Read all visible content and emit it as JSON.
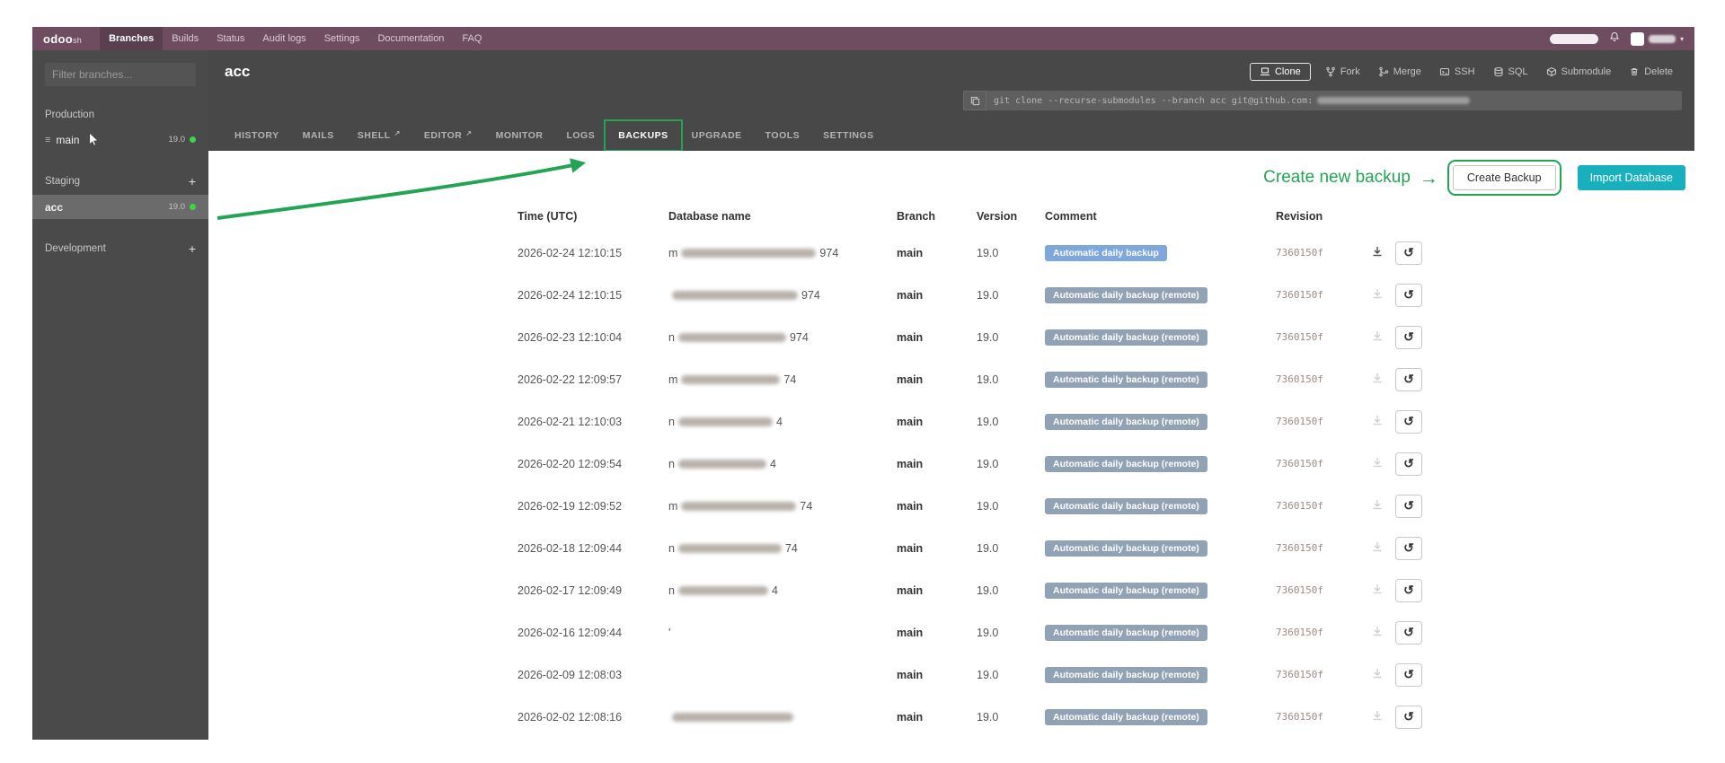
{
  "navbar": {
    "brand": "odoo",
    "brand_suffix": "sh",
    "items": [
      "Branches",
      "Builds",
      "Status",
      "Audit logs",
      "Settings",
      "Documentation",
      "FAQ"
    ],
    "active_item": "Branches"
  },
  "sidebar": {
    "filter_placeholder": "Filter branches...",
    "sections": [
      {
        "label": "Production",
        "can_add": false,
        "branches": [
          {
            "name": "main",
            "version": "19.0",
            "selected": false,
            "handle": true
          }
        ]
      },
      {
        "label": "Staging",
        "can_add": true,
        "branches": [
          {
            "name": "acc",
            "version": "19.0",
            "selected": true,
            "handle": false
          }
        ]
      },
      {
        "label": "Development",
        "can_add": true,
        "branches": []
      }
    ]
  },
  "header": {
    "branch_title": "acc",
    "actions": [
      "Clone",
      "Fork",
      "Merge",
      "SSH",
      "SQL",
      "Submodule",
      "Delete"
    ],
    "git_command_prefix": "git clone --recurse-submodules --branch acc git@github.com:"
  },
  "tabs": {
    "items": [
      "HISTORY",
      "MAILS",
      "SHELL",
      "EDITOR",
      "MONITOR",
      "LOGS",
      "BACKUPS",
      "UPGRADE",
      "TOOLS",
      "SETTINGS"
    ],
    "active": "BACKUPS",
    "external": [
      "SHELL",
      "EDITOR"
    ]
  },
  "annotation": {
    "label": "Create new backup",
    "arrow": "→",
    "color": "#23a455"
  },
  "icons": {
    "restore": "↺"
  },
  "colors": {
    "annotation_green": "#23a455",
    "badge_primary": "#7da7dd",
    "badge_remote": "#90a2b3",
    "import_teal": "#18b0bd",
    "status_dot_green": "#3fd24a"
  },
  "backups": {
    "create_button": "Create Backup",
    "import_button": "Import Database",
    "columns": [
      "Time (UTC)",
      "Database name",
      "Branch",
      "Version",
      "Comment",
      "Revision"
    ],
    "rows": [
      {
        "time": "2026-02-24 12:10:15",
        "db_prefix": "m",
        "db_redacted_width": 150,
        "db_suffix": "974",
        "branch": "main",
        "version": "19.0",
        "comment": "Automatic daily backup",
        "comment_style": "primary",
        "revision": "7360150f",
        "download_enabled": true
      },
      {
        "time": "2026-02-24 12:10:15",
        "db_prefix": "",
        "db_redacted_width": 140,
        "db_suffix": "974",
        "branch": "main",
        "version": "19.0",
        "comment": "Automatic daily backup (remote)",
        "comment_style": "remote",
        "revision": "7360150f",
        "download_enabled": false
      },
      {
        "time": "2026-02-23 12:10:04",
        "db_prefix": "n",
        "db_redacted_width": 120,
        "db_suffix": "974",
        "branch": "main",
        "version": "19.0",
        "comment": "Automatic daily backup (remote)",
        "comment_style": "remote",
        "revision": "7360150f",
        "download_enabled": false
      },
      {
        "time": "2026-02-22 12:09:57",
        "db_prefix": "m",
        "db_redacted_width": 110,
        "db_suffix": "74",
        "branch": "main",
        "version": "19.0",
        "comment": "Automatic daily backup (remote)",
        "comment_style": "remote",
        "revision": "7360150f",
        "download_enabled": false
      },
      {
        "time": "2026-02-21 12:10:03",
        "db_prefix": "n",
        "db_redacted_width": 105,
        "db_suffix": "4",
        "branch": "main",
        "version": "19.0",
        "comment": "Automatic daily backup (remote)",
        "comment_style": "remote",
        "revision": "7360150f",
        "download_enabled": false
      },
      {
        "time": "2026-02-20 12:09:54",
        "db_prefix": "n",
        "db_redacted_width": 98,
        "db_suffix": "4",
        "branch": "main",
        "version": "19.0",
        "comment": "Automatic daily backup (remote)",
        "comment_style": "remote",
        "revision": "7360150f",
        "download_enabled": false
      },
      {
        "time": "2026-02-19 12:09:52",
        "db_prefix": "m",
        "db_redacted_width": 128,
        "db_suffix": "74",
        "branch": "main",
        "version": "19.0",
        "comment": "Automatic daily backup (remote)",
        "comment_style": "remote",
        "revision": "7360150f",
        "download_enabled": false
      },
      {
        "time": "2026-02-18 12:09:44",
        "db_prefix": "n",
        "db_redacted_width": 115,
        "db_suffix": "74",
        "branch": "main",
        "version": "19.0",
        "comment": "Automatic daily backup (remote)",
        "comment_style": "remote",
        "revision": "7360150f",
        "download_enabled": false
      },
      {
        "time": "2026-02-17 12:09:49",
        "db_prefix": "n",
        "db_redacted_width": 100,
        "db_suffix": "4",
        "branch": "main",
        "version": "19.0",
        "comment": "Automatic daily backup (remote)",
        "comment_style": "remote",
        "revision": "7360150f",
        "download_enabled": false
      },
      {
        "time": "2026-02-16 12:09:44",
        "db_prefix": "'",
        "db_redacted_width": 0,
        "db_suffix": "",
        "branch": "main",
        "version": "19.0",
        "comment": "Automatic daily backup (remote)",
        "comment_style": "remote",
        "revision": "7360150f",
        "download_enabled": false
      },
      {
        "time": "2026-02-09 12:08:03",
        "db_prefix": "",
        "db_redacted_width": 0,
        "db_suffix": "",
        "branch": "main",
        "version": "19.0",
        "comment": "Automatic daily backup (remote)",
        "comment_style": "remote",
        "revision": "7360150f",
        "download_enabled": false
      },
      {
        "time": "2026-02-02 12:08:16",
        "db_prefix": "",
        "db_redacted_width": 135,
        "db_suffix": "",
        "branch": "main",
        "version": "19.0",
        "comment": "Automatic daily backup (remote)",
        "comment_style": "remote",
        "revision": "7360150f",
        "download_enabled": false
      }
    ]
  }
}
